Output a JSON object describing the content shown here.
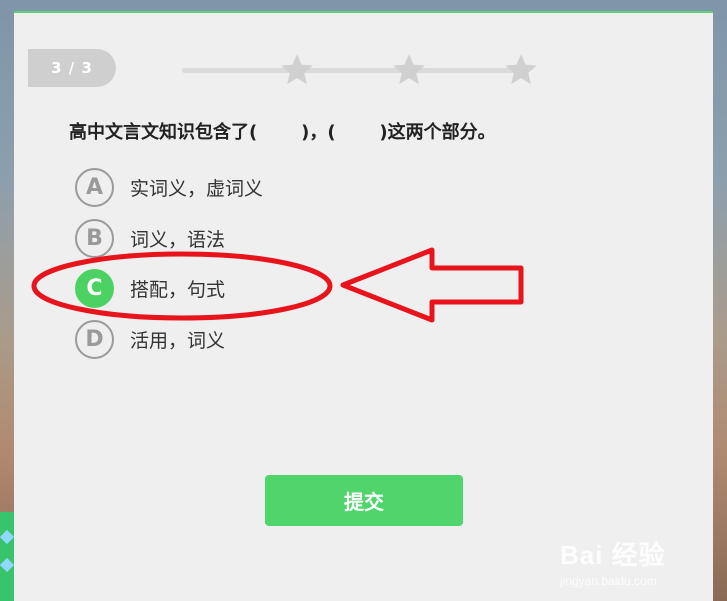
{
  "quiz": {
    "counter": "3 / 3",
    "question": "高中文言文知识包含了(       )，(       )这两个部分。",
    "options": [
      {
        "letter": "A",
        "text": "实词义，虚词义",
        "selected": false
      },
      {
        "letter": "B",
        "text": "词义，语法",
        "selected": false
      },
      {
        "letter": "C",
        "text": "搭配，句式",
        "selected": true
      },
      {
        "letter": "D",
        "text": "活用，词义",
        "selected": false
      }
    ],
    "submit_label": "提交"
  },
  "progress": {
    "stars_total": 3,
    "star_icon": "star-icon",
    "color": "#d0d0d0"
  },
  "watermark": {
    "logo": "Bai 经验",
    "site": "jingyan.baidu.com"
  },
  "colors": {
    "accent": "#4cd263",
    "annotation": "#e8141c"
  }
}
